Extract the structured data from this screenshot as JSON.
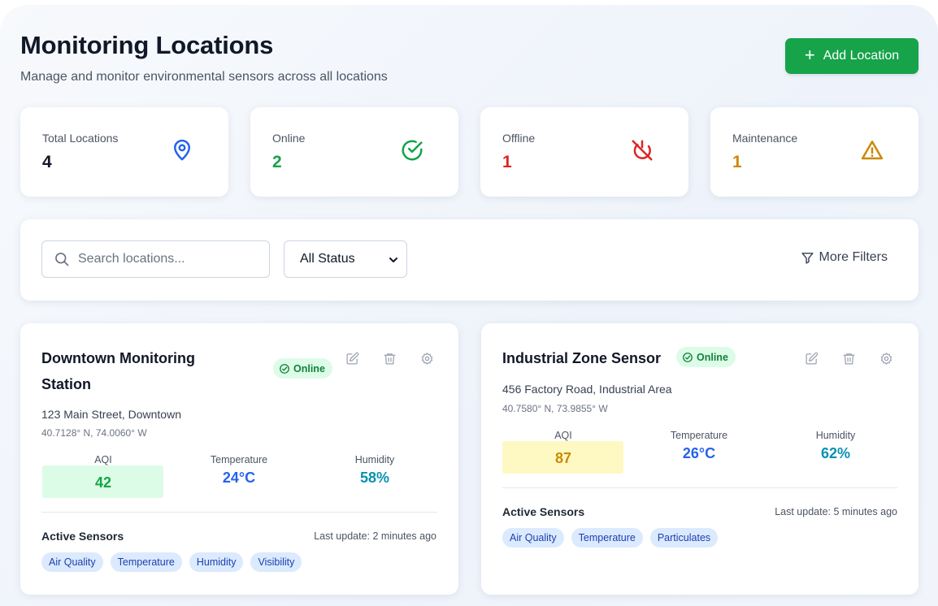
{
  "header": {
    "title": "Monitoring Locations",
    "subtitle": "Manage and monitor environmental sensors across all locations",
    "add_button_label": "Add Location"
  },
  "stats": [
    {
      "label": "Total Locations",
      "value": "4",
      "color": "#111827",
      "icon": "map-pin-icon",
      "icon_color": "#2563eb"
    },
    {
      "label": "Online",
      "value": "2",
      "color": "#16a34a",
      "icon": "check-circle-icon",
      "icon_color": "#16a34a"
    },
    {
      "label": "Offline",
      "value": "1",
      "color": "#dc2626",
      "icon": "power-off-icon",
      "icon_color": "#dc2626"
    },
    {
      "label": "Maintenance",
      "value": "1",
      "color": "#ca8a04",
      "icon": "warning-icon",
      "icon_color": "#ca8a04"
    }
  ],
  "filters": {
    "search_placeholder": "Search locations...",
    "status_selected": "All Status",
    "more_filters_label": "More Filters"
  },
  "locations": [
    {
      "name_line1": "Downtown Monitoring",
      "name_line2": "Station",
      "status": "Online",
      "address": "123 Main Street, Downtown",
      "coords": "40.7128° N, 74.0060° W",
      "aqi_label": "AQI",
      "aqi": "42",
      "aqi_color": "#16a34a",
      "aqi_bg": "#dcfce7",
      "temp_label": "Temperature",
      "temperature": "24°C",
      "humidity_label": "Humidity",
      "humidity": "58%",
      "sensors_title": "Active Sensors",
      "last_update": "Last update: 2 minutes ago",
      "sensors": [
        "Air Quality",
        "Temperature",
        "Humidity",
        "Visibility"
      ]
    },
    {
      "name_line1": "Industrial Zone Sensor",
      "status": "Online",
      "address": "456 Factory Road, Industrial Area",
      "coords": "40.7580° N, 73.9855° W",
      "aqi_label": "AQI",
      "aqi": "87",
      "aqi_color": "#ca8a04",
      "aqi_bg": "#fef9c3",
      "temp_label": "Temperature",
      "temperature": "26°C",
      "humidity_label": "Humidity",
      "humidity": "62%",
      "sensors_title": "Active Sensors",
      "last_update": "Last update: 5 minutes ago",
      "sensors": [
        "Air Quality",
        "Temperature",
        "Particulates"
      ]
    }
  ],
  "colors": {
    "accent_green": "#16a34a",
    "temperature_blue": "#2563eb",
    "humidity_teal": "#0891b2"
  }
}
